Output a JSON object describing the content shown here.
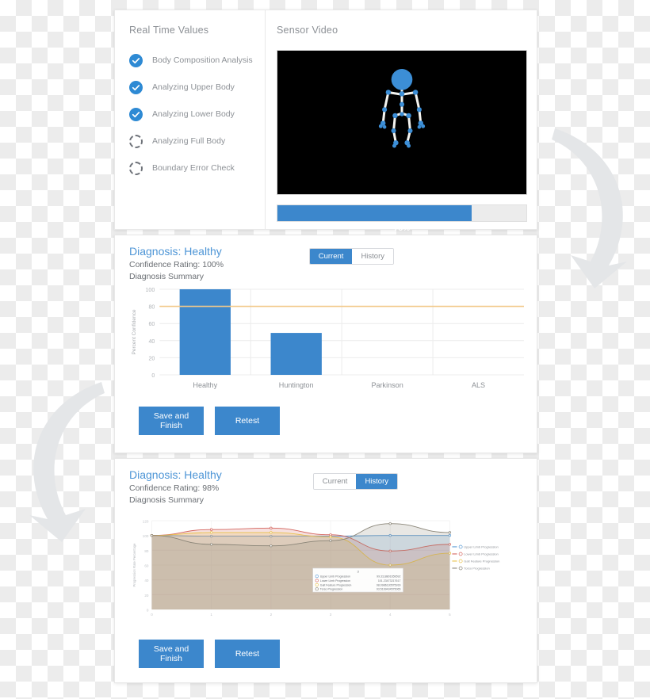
{
  "realtime": {
    "title": "Real Time Values",
    "items": [
      {
        "label": "Body Composition Analysis",
        "state": "done"
      },
      {
        "label": "Analyzing Upper Body",
        "state": "done"
      },
      {
        "label": "Analyzing Lower Body",
        "state": "done"
      },
      {
        "label": "Analyzing Full Body",
        "state": "pending"
      },
      {
        "label": "Boundary Error Check",
        "state": "pending"
      }
    ],
    "video_title": "Sensor Video",
    "progress_label": "78%",
    "progress_value": 78
  },
  "current": {
    "diagnosis": "Diagnosis: Healthy",
    "confidence": "Confidence Rating: 100%",
    "summary": "Diagnosis Summary",
    "tabs": [
      {
        "label": "Current",
        "active": true
      },
      {
        "label": "History",
        "active": false
      }
    ],
    "buttons": [
      {
        "label": "Save and Finish"
      },
      {
        "label": "Retest"
      }
    ]
  },
  "history": {
    "diagnosis": "Diagnosis: Healthy",
    "confidence": "Confidence Rating: 98%",
    "summary": "Diagnosis Summary",
    "tabs": [
      {
        "label": "Current",
        "active": false
      },
      {
        "label": "History",
        "active": true
      }
    ],
    "buttons": [
      {
        "label": "Save and Finish"
      },
      {
        "label": "Retest"
      }
    ],
    "tooltip": {
      "header": "3",
      "rows": [
        {
          "label": "Upper Limb Progression",
          "value": "99.3118801659592",
          "color": "#5b9bd5"
        },
        {
          "label": "Lower Limb Progression",
          "value": "101.23473217617",
          "color": "#d4665f"
        },
        {
          "label": "Gait Feature Progression",
          "value": "98.0986130575939",
          "color": "#e8c04a"
        },
        {
          "label": "Torso Progression",
          "value": "93.5169434575065",
          "color": "#8a8578"
        }
      ]
    }
  },
  "colors": {
    "accent": "#3c87cc",
    "bar": "#3c87cc",
    "threshold": "#f2c98a",
    "title": "#4d95d6"
  },
  "chart_data": [
    {
      "type": "bar",
      "id": "current-confidence-bar",
      "title": "",
      "xlabel": "",
      "ylabel": "Percent Confidence",
      "categories": [
        "Healthy",
        "Huntington",
        "Parkinson",
        "ALS"
      ],
      "values": [
        100,
        49,
        0,
        0
      ],
      "ylim": [
        0,
        100
      ],
      "yticks": [
        0,
        20,
        40,
        60,
        80,
        100
      ],
      "threshold": 80,
      "grid": true,
      "legend": "none"
    },
    {
      "type": "area",
      "id": "history-progression",
      "title": "",
      "xlabel": "",
      "ylabel": "Progression Rate Percentage",
      "x": [
        0,
        1,
        2,
        3,
        4,
        5
      ],
      "xticks": [
        "0",
        "1",
        "2",
        "3",
        "4",
        "5"
      ],
      "ylim": [
        0,
        120
      ],
      "yticks": [
        0,
        20,
        40,
        60,
        80,
        100,
        120
      ],
      "grid": true,
      "legend": "right",
      "series": [
        {
          "name": "Upper Limb Progression",
          "color": "#5b9bd5",
          "values": [
            100,
            99,
            99,
            99,
            100,
            100
          ]
        },
        {
          "name": "Lower Limb Progression",
          "color": "#d4665f",
          "values": [
            100,
            108,
            110,
            101,
            79,
            88
          ]
        },
        {
          "name": "Gait Feature Progression",
          "color": "#e8c04a",
          "values": [
            100,
            104,
            104,
            98,
            60,
            76
          ]
        },
        {
          "name": "Torso Progression",
          "color": "#8a8578",
          "values": [
            100,
            88,
            86,
            93,
            116,
            104
          ]
        }
      ]
    }
  ]
}
